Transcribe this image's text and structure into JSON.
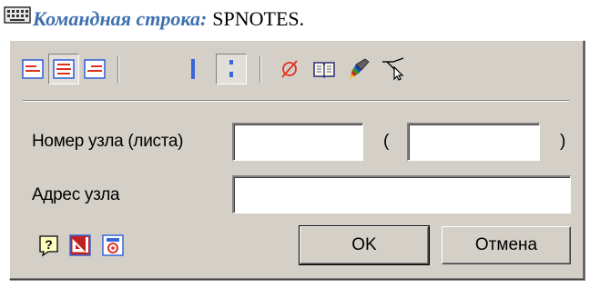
{
  "caption": {
    "label": "Командная строка:",
    "command": "SPNOTES."
  },
  "toolbar": {
    "icons": [
      "align-left-icon",
      "align-center-icon",
      "align-right-icon",
      "single-line-icon",
      "dotted-line-icon",
      "diameter-icon",
      "book-icon",
      "paint-brush-icon",
      "leader-pointer-icon"
    ],
    "pressed": [
      "align-center-icon",
      "dotted-line-icon"
    ]
  },
  "form": {
    "node_number_label": "Номер узла (листа)",
    "node_number_value": "",
    "sheet_open_paren": "(",
    "sheet_value": "",
    "sheet_close_paren": ")",
    "node_address_label": "Адрес узла",
    "node_address_value": ""
  },
  "bottom_icons": [
    "help-icon",
    "geometry-icon",
    "settings-icon"
  ],
  "buttons": {
    "ok": "OK",
    "cancel": "Отмена"
  },
  "colors": {
    "caption_label": "#3e71b0",
    "dialog_bg": "#d4d0c8",
    "icon_blue": "#3a66d8",
    "icon_red": "#e03020"
  }
}
